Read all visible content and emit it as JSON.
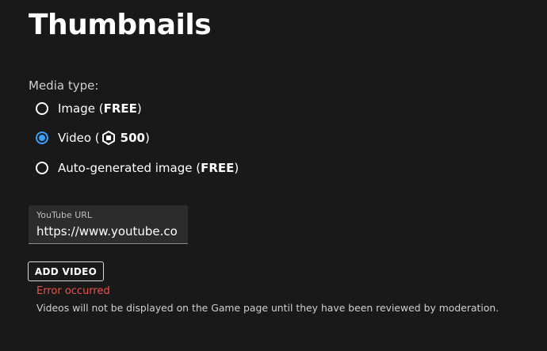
{
  "page": {
    "title": "Thumbnails"
  },
  "media_type": {
    "label": "Media type:",
    "options": [
      {
        "label": "Image (",
        "price": "FREE",
        "suffix": ")",
        "selected": false
      },
      {
        "label": "Video (",
        "price": "500",
        "suffix": ")",
        "selected": true,
        "icon": "robux-icon"
      },
      {
        "label": "Auto-generated image (",
        "price": "FREE",
        "suffix": ")",
        "selected": false
      }
    ]
  },
  "youtube": {
    "label": "YouTube URL",
    "value": "https://www.youtube.co"
  },
  "actions": {
    "add_video_label": "ADD VIDEO"
  },
  "status": {
    "error": "Error occurred",
    "notice": "Videos will not be displayed on the Game page until they have been reviewed by moderation."
  },
  "colors": {
    "background": "#191919",
    "accent": "#3aa0ff",
    "error": "#e8534d"
  }
}
